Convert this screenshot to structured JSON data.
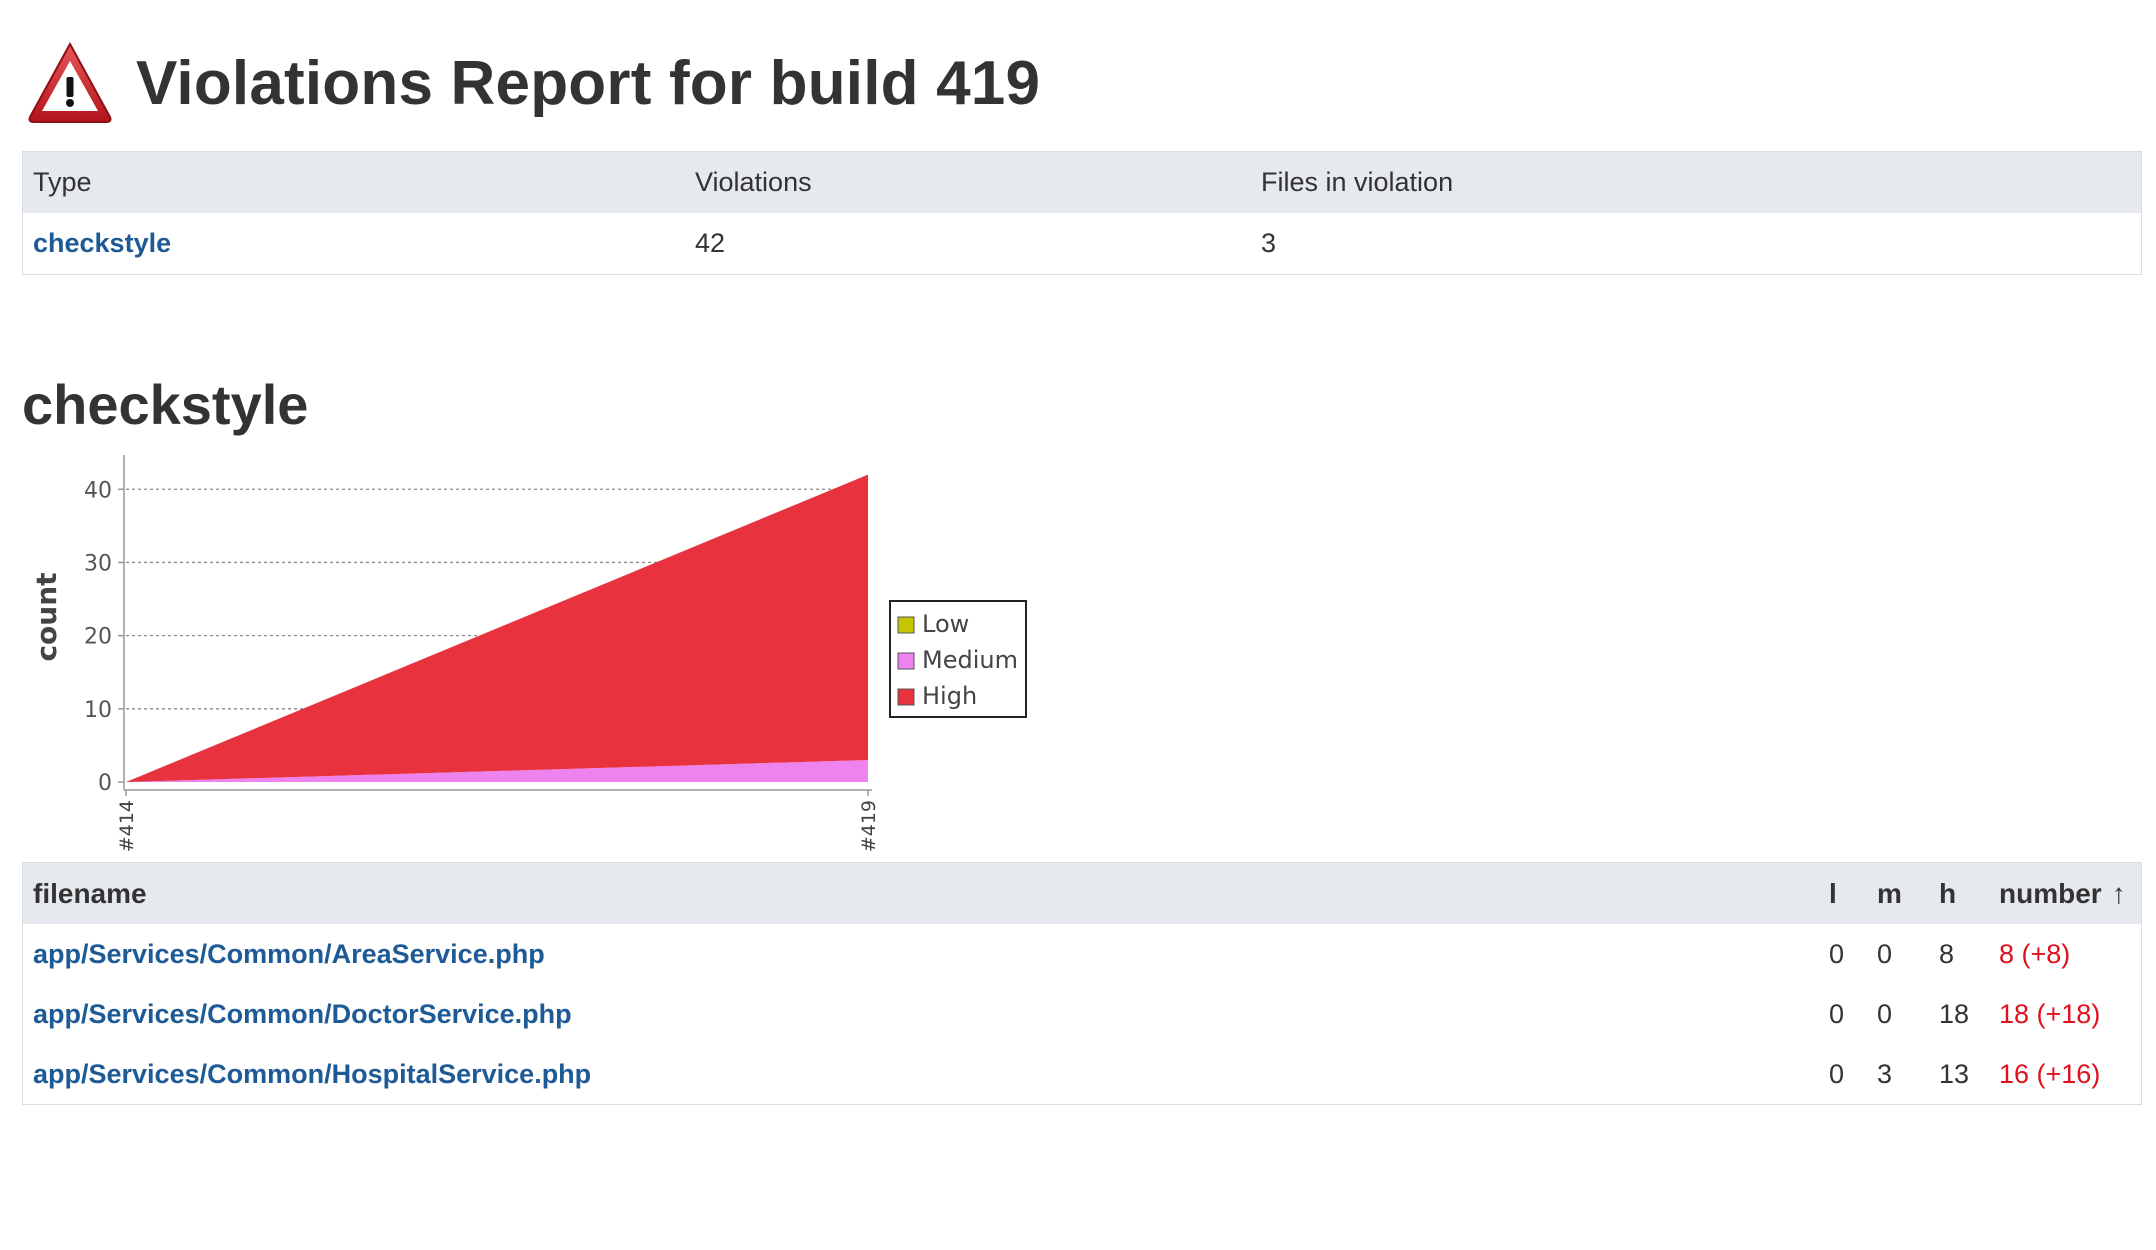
{
  "header": {
    "title": "Violations Report for build 419",
    "icon": "warning-triangle-icon"
  },
  "summary": {
    "columns": [
      "Type",
      "Violations",
      "Files in violation"
    ],
    "rows": [
      {
        "type": "checkstyle",
        "violations": "42",
        "files": "3"
      }
    ]
  },
  "section": {
    "title": "checkstyle"
  },
  "chart_data": {
    "type": "area",
    "stacked": true,
    "ylabel": "count",
    "xlabel": "",
    "categories": [
      "#414",
      "#419"
    ],
    "ylim": [
      0,
      44
    ],
    "yticks": [
      0,
      10,
      20,
      30,
      40
    ],
    "grid": true,
    "legend_position": "right",
    "series": [
      {
        "name": "Low",
        "values": [
          0,
          0
        ],
        "color": "#c6c600"
      },
      {
        "name": "Medium",
        "values": [
          0,
          3
        ],
        "color": "#ee82ee"
      },
      {
        "name": "High",
        "values": [
          0,
          39
        ],
        "color": "#e8333f"
      }
    ]
  },
  "files": {
    "columns": {
      "filename": "filename",
      "l": "l",
      "m": "m",
      "h": "h",
      "number": "number",
      "sort_indicator": "↑"
    },
    "rows": [
      {
        "filename": "app/Services/Common/AreaService.php",
        "l": "0",
        "m": "0",
        "h": "8",
        "number": "8 (+8)"
      },
      {
        "filename": "app/Services/Common/DoctorService.php",
        "l": "0",
        "m": "0",
        "h": "18",
        "number": "18 (+18)"
      },
      {
        "filename": "app/Services/Common/HospitalService.php",
        "l": "0",
        "m": "3",
        "h": "13",
        "number": "16 (+16)"
      }
    ]
  },
  "colors": {
    "link": "#1e5b96",
    "delta": "#e0101d",
    "header_bg": "#e6eaee"
  }
}
